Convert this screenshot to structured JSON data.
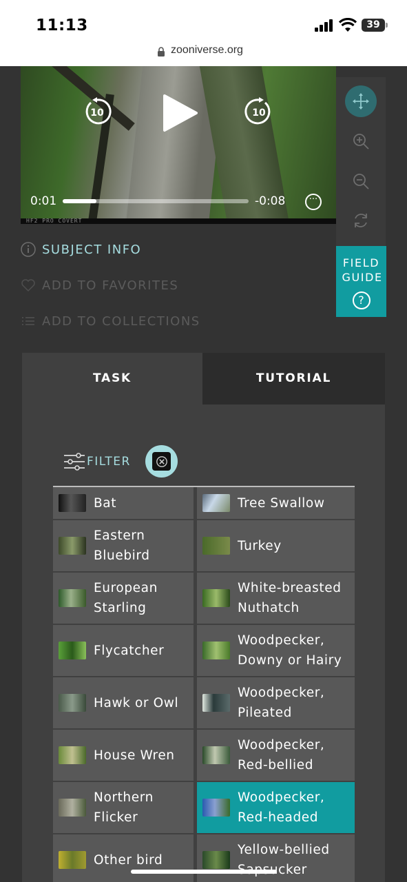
{
  "status_bar": {
    "time": "11:13",
    "battery": "39"
  },
  "browser": {
    "url": "zooniverse.org"
  },
  "video": {
    "current_time": "0:01",
    "remaining_time": "-0:08",
    "progress": 0.18,
    "skip_back_label": "10",
    "skip_forward_label": "10",
    "camera_brand": "HF2 PRO COVERT",
    "more_glyph": "···"
  },
  "image_tools": [
    "move-icon",
    "zoom-in-icon",
    "zoom-out-icon",
    "rotate-icon"
  ],
  "field_guide": {
    "label": "FIELD GUIDE",
    "help_glyph": "?"
  },
  "subject_links": {
    "info": "SUBJECT INFO",
    "favorites": "ADD TO FAVORITES",
    "collections": "ADD TO COLLECTIONS"
  },
  "tabs": {
    "task": "TASK",
    "tutorial": "TUTORIAL"
  },
  "filter": {
    "label": "FILTER"
  },
  "choices": {
    "left": [
      {
        "label": "Bat",
        "lines": 1
      },
      {
        "label": "Eastern Bluebird",
        "lines": 2
      },
      {
        "label": "European Starling",
        "lines": 2
      },
      {
        "label": "Flycatcher",
        "lines": 1
      },
      {
        "label": "Hawk or Owl",
        "lines": 1
      },
      {
        "label": "House Wren",
        "lines": 1
      },
      {
        "label": "Northern Flicker",
        "lines": 2
      },
      {
        "label": "Other bird",
        "lines": 1
      }
    ],
    "right": [
      {
        "label": "Tree Swallow",
        "lines": 1
      },
      {
        "label": "Turkey",
        "lines": 1
      },
      {
        "label": "White-breasted Nuthatch",
        "lines": 2
      },
      {
        "label": "Woodpecker, Downy or Hairy",
        "lines": 2
      },
      {
        "label": "Woodpecker, Pileated",
        "lines": 2
      },
      {
        "label": "Woodpecker, Red-bellied",
        "lines": 2
      },
      {
        "label": "Woodpecker, Red-headed",
        "lines": 2,
        "selected": true
      },
      {
        "label": "Yellow-bellied Sapsucker",
        "lines": 2
      }
    ]
  },
  "colors": {
    "accent": "#119ca0",
    "link": "#a6dde0",
    "panel": "#404040",
    "cell": "#585858"
  }
}
